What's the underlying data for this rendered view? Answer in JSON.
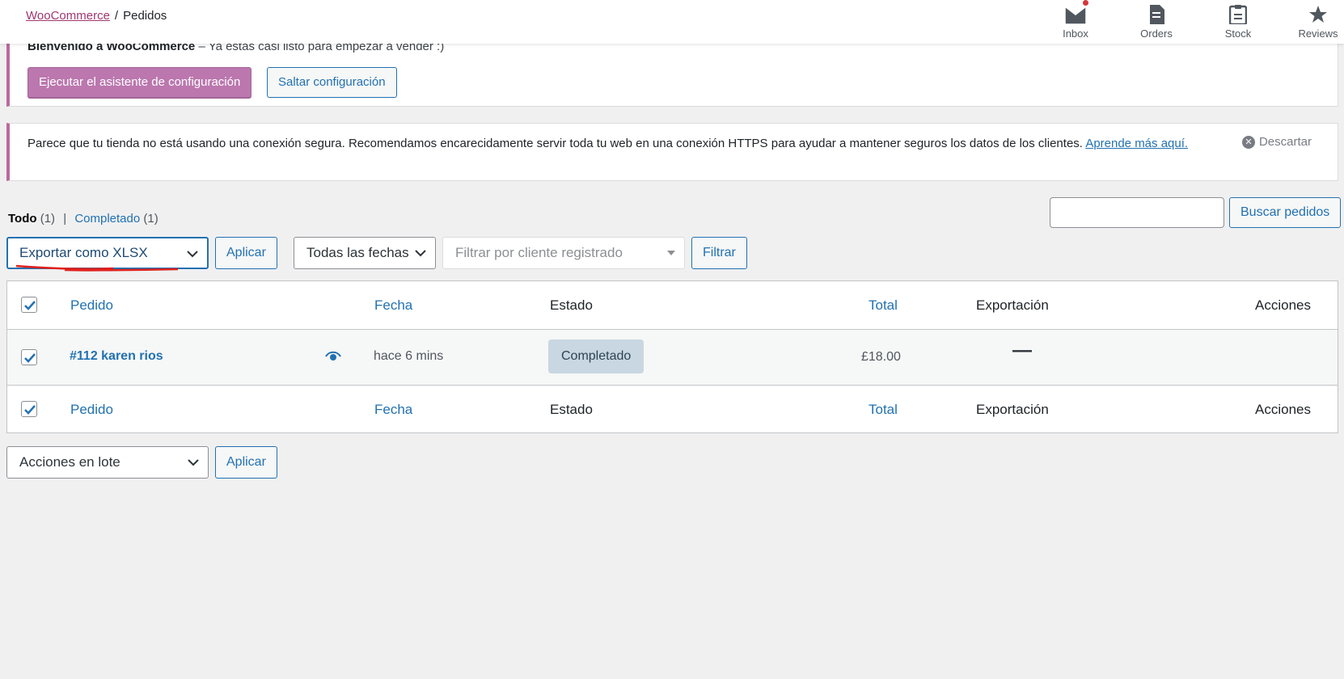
{
  "header": {
    "breadcrumb_root": "WooCommerce",
    "breadcrumb_sep": "/",
    "breadcrumb_current": "Pedidos",
    "activity": [
      {
        "label": "Inbox",
        "icon": "inbox-icon",
        "has_unread": true
      },
      {
        "label": "Orders",
        "icon": "orders-icon"
      },
      {
        "label": "Stock",
        "icon": "stock-icon"
      },
      {
        "label": "Reviews",
        "icon": "star-icon"
      }
    ]
  },
  "welcome_notice": {
    "title": "Bienvenido a WooCommerce",
    "text": " – Ya estás casi listo para empezar a vender :)",
    "primary_button": "Ejecutar el asistente de configuración",
    "secondary_button": "Saltar configuración"
  },
  "https_notice": {
    "text": "Parece que tu tienda no está usando una conexión segura. Recomendamos encarecidamente servir toda tu web en una conexión HTTPS para ayudar a mantener seguros los datos de los clientes.",
    "link": "Aprende más aquí.",
    "dismiss": "Descartar"
  },
  "filters": {
    "all_label": "Todo",
    "all_count": "(1)",
    "separator": "|",
    "completed_label": "Completado",
    "completed_count": "(1)",
    "search_value": "",
    "search_button": "Buscar pedidos",
    "bulk_action_top": "Exportar como XLSX",
    "apply_top": "Aplicar",
    "date_filter": "Todas las fechas",
    "customer_filter_placeholder": "Filtrar por cliente registrado",
    "filter_button": "Filtrar",
    "bulk_action_bottom": "Acciones en lote",
    "apply_bottom": "Aplicar"
  },
  "table": {
    "columns": {
      "order": "Pedido",
      "date": "Fecha",
      "status": "Estado",
      "total": "Total",
      "export": "Exportación",
      "actions": "Acciones"
    },
    "rows": [
      {
        "order": "#112 karen rios",
        "date": "hace 6 mins",
        "status": "Completado",
        "total": "£18.00",
        "export": "—",
        "checked": true
      }
    ],
    "header_checked": true,
    "footer_checked": true
  },
  "colors": {
    "accent": "#2271b1",
    "woo_purple": "#bb77ae",
    "notice_border": "#b96a9e",
    "status_completed_bg": "#c8d7e1",
    "annotation_red": "#e0201b"
  }
}
